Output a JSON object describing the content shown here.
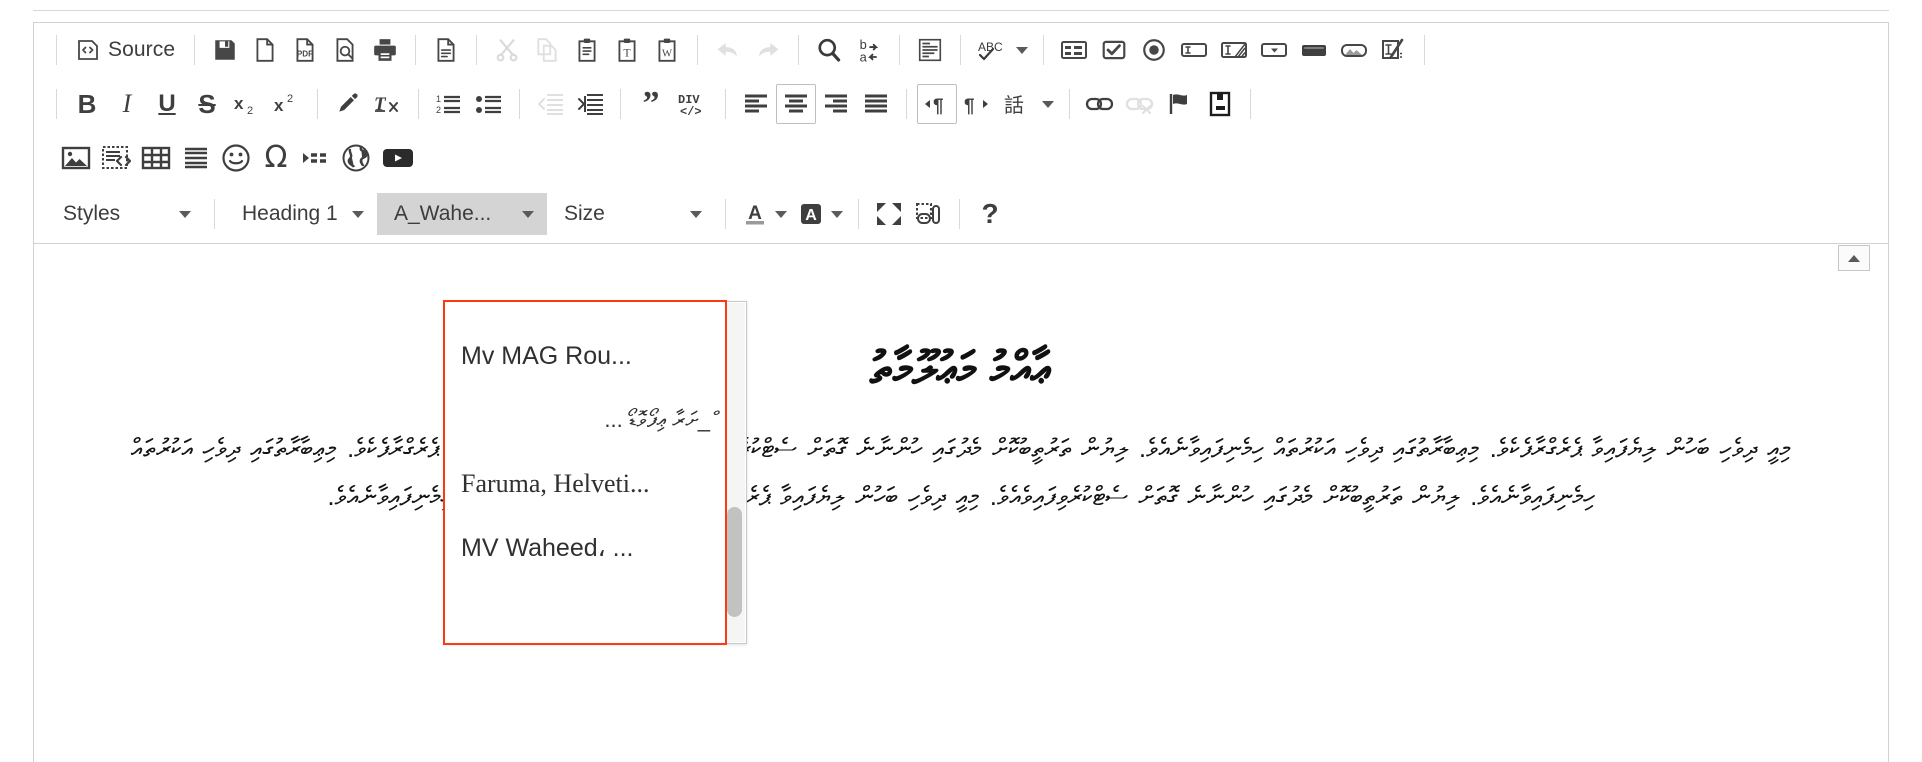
{
  "editor": {
    "name": "rich-text-editor"
  },
  "toolbar": {
    "row1": [
      {
        "name": "source-button",
        "label": "Source",
        "icon": "source-code-icon",
        "type": "text",
        "state": "normal"
      },
      {
        "type": "separator"
      },
      {
        "name": "save-button",
        "icon": "floppy-disk-icon",
        "state": "normal"
      },
      {
        "name": "new-page-button",
        "icon": "blank-page-icon",
        "state": "normal"
      },
      {
        "name": "export-pdf-button",
        "icon": "pdf-page-icon",
        "state": "normal"
      },
      {
        "name": "preview-button",
        "icon": "page-magnifier-icon",
        "state": "normal"
      },
      {
        "name": "print-button",
        "icon": "printer-icon",
        "state": "normal"
      },
      {
        "type": "separator"
      },
      {
        "name": "templates-button",
        "icon": "document-lines-icon",
        "state": "normal"
      },
      {
        "type": "separator"
      },
      {
        "name": "cut-button",
        "icon": "scissors-icon",
        "state": "disabled"
      },
      {
        "name": "copy-button",
        "icon": "copy-pages-icon",
        "state": "disabled"
      },
      {
        "name": "paste-button",
        "icon": "clipboard-icon",
        "state": "normal"
      },
      {
        "name": "paste-as-text-button",
        "icon": "clipboard-text-icon",
        "state": "normal"
      },
      {
        "name": "paste-from-word-button",
        "icon": "clipboard-word-icon",
        "state": "normal"
      },
      {
        "type": "separator"
      },
      {
        "name": "undo-button",
        "icon": "undo-arrow-icon",
        "state": "disabled"
      },
      {
        "name": "redo-button",
        "icon": "redo-arrow-icon",
        "state": "disabled"
      },
      {
        "type": "separator"
      },
      {
        "name": "find-button",
        "icon": "magnifier-icon",
        "state": "normal"
      },
      {
        "name": "replace-button",
        "icon": "find-replace-icon",
        "state": "normal"
      },
      {
        "type": "separator"
      },
      {
        "name": "select-all-button",
        "icon": "select-all-icon",
        "state": "normal"
      },
      {
        "type": "separator"
      },
      {
        "name": "spell-check-button",
        "icon": "abc-spellcheck-icon",
        "state": "normal",
        "hasCaret": true
      },
      {
        "type": "separator"
      },
      {
        "name": "form-button",
        "icon": "form-icon",
        "state": "normal"
      },
      {
        "name": "checkbox-button",
        "icon": "checkbox-icon",
        "state": "normal"
      },
      {
        "name": "radio-button",
        "icon": "radio-button-icon",
        "state": "normal"
      },
      {
        "name": "text-field-button",
        "icon": "text-field-icon",
        "state": "normal"
      },
      {
        "name": "textarea-button",
        "icon": "textarea-icon",
        "state": "normal"
      },
      {
        "name": "select-field-button",
        "icon": "select-field-icon",
        "state": "normal"
      },
      {
        "name": "button-field-button",
        "icon": "push-button-icon",
        "state": "normal"
      },
      {
        "name": "image-button-button",
        "icon": "image-button-icon",
        "state": "normal"
      },
      {
        "name": "hidden-field-button",
        "icon": "hidden-field-icon",
        "state": "normal"
      }
    ],
    "row2": [
      {
        "name": "bold-button",
        "icon": "bold-icon",
        "glyph": "B",
        "state": "normal"
      },
      {
        "name": "italic-button",
        "icon": "italic-icon",
        "glyph": "I",
        "state": "normal"
      },
      {
        "name": "underline-button",
        "icon": "underline-icon",
        "glyph": "U",
        "state": "normal"
      },
      {
        "name": "strikethrough-button",
        "icon": "strikethrough-icon",
        "glyph": "S",
        "state": "normal"
      },
      {
        "name": "subscript-button",
        "icon": "subscript-icon",
        "state": "normal"
      },
      {
        "name": "superscript-button",
        "icon": "superscript-icon",
        "state": "normal"
      },
      {
        "type": "separator"
      },
      {
        "name": "remove-format-button",
        "icon": "paintbrush-icon",
        "state": "normal"
      },
      {
        "name": "clear-text-format-button",
        "icon": "text-clear-icon",
        "state": "normal"
      },
      {
        "type": "separator"
      },
      {
        "name": "numbered-list-button",
        "icon": "numbered-list-icon",
        "state": "normal"
      },
      {
        "name": "bulleted-list-button",
        "icon": "bulleted-list-icon",
        "state": "normal"
      },
      {
        "type": "separator"
      },
      {
        "name": "decrease-indent-button",
        "icon": "outdent-icon",
        "state": "disabled"
      },
      {
        "name": "increase-indent-button",
        "icon": "indent-icon",
        "state": "normal"
      },
      {
        "type": "separator"
      },
      {
        "name": "blockquote-button",
        "icon": "quote-icon",
        "state": "normal"
      },
      {
        "name": "create-div-button",
        "icon": "div-container-icon",
        "state": "normal"
      },
      {
        "type": "separator"
      },
      {
        "name": "align-left-button",
        "icon": "align-left-icon",
        "state": "normal"
      },
      {
        "name": "align-center-button",
        "icon": "align-center-icon",
        "state": "active"
      },
      {
        "name": "align-right-button",
        "icon": "align-right-icon",
        "state": "normal"
      },
      {
        "name": "align-justify-button",
        "icon": "align-justify-icon",
        "state": "normal"
      },
      {
        "type": "separator"
      },
      {
        "name": "text-direction-rtl-button",
        "icon": "paragraph-rtl-icon",
        "state": "active"
      },
      {
        "name": "text-direction-ltr-button",
        "icon": "paragraph-ltr-icon",
        "state": "normal"
      },
      {
        "name": "language-button",
        "icon": "language-cjk-icon",
        "state": "normal",
        "hasCaret": true
      },
      {
        "type": "separator"
      },
      {
        "name": "link-button",
        "icon": "link-icon",
        "state": "normal"
      },
      {
        "name": "unlink-button",
        "icon": "unlink-icon",
        "state": "disabled"
      },
      {
        "name": "anchor-button",
        "icon": "flag-anchor-icon",
        "state": "normal"
      },
      {
        "name": "save-doc-button",
        "icon": "save-doc-icon",
        "state": "normal"
      },
      {
        "type": "separator"
      }
    ],
    "row3": [
      {
        "name": "insert-image-button",
        "icon": "picture-icon",
        "state": "normal"
      },
      {
        "name": "code-snippet-button",
        "icon": "code-snippet-icon",
        "state": "normal"
      },
      {
        "name": "insert-table-button",
        "icon": "table-icon",
        "state": "normal"
      },
      {
        "name": "horizontal-rule-button",
        "icon": "horizontal-rule-icon",
        "state": "normal"
      },
      {
        "name": "smiley-button",
        "icon": "smiley-icon",
        "state": "normal"
      },
      {
        "name": "special-character-button",
        "icon": "omega-icon",
        "state": "normal"
      },
      {
        "name": "page-break-button",
        "icon": "page-break-icon",
        "state": "normal"
      },
      {
        "name": "iframe-button",
        "icon": "globe-icon",
        "state": "normal"
      },
      {
        "name": "youtube-button",
        "icon": "youtube-icon",
        "state": "normal"
      }
    ],
    "row4": {
      "styles": {
        "name": "styles-combo",
        "value": "Styles"
      },
      "format": {
        "name": "paragraph-format-combo",
        "value": "Heading 1"
      },
      "font": {
        "name": "font-family-combo",
        "value": "A_Wahe..."
      },
      "size": {
        "name": "font-size-combo",
        "value": "Size"
      },
      "text_color": {
        "name": "text-color-button",
        "icon": "text-color-icon"
      },
      "bg_color": {
        "name": "background-color-button",
        "icon": "background-color-icon"
      },
      "maximize": {
        "name": "maximize-button",
        "icon": "maximize-arrows-icon"
      },
      "show_blocks": {
        "name": "show-blocks-button",
        "icon": "show-blocks-icon"
      },
      "about": {
        "name": "about-button",
        "label": "?"
      }
    },
    "collapse": {
      "name": "collapse-toolbar-button",
      "icon": "chevron-up-icon"
    }
  },
  "font_dropdown": {
    "name": "font-family-dropdown",
    "items": [
      {
        "label": "Mv MAG Rou...",
        "style": "sans"
      },
      {
        "label": "ް_ށަރާ ޢިފޯވޮޑޯ ...",
        "style": "thaana"
      },
      {
        "label": "Faruma,  Helveti...",
        "style": "serif"
      },
      {
        "label": "MV  Waheed،  ...",
        "style": "sans"
      }
    ],
    "highlight_color": "#f93a12"
  },
  "document": {
    "name": "document-body",
    "heading": "ޢާއްމު މަޢުލޫމާތު",
    "paragraph": "މިއީ ދިވެހި ބަހުން ލިޔެފައިވާ ޕެރެގްރާފެކެވެ. މިޢިބާރާތުގައި ދިވެހި އަކުރުތައް ހިމެނިފައިވާނެއެވެ. ލިޔުން ތަރުތީބުކޮށް މެދުގައި ހުންނާނެ ގޮތަށް ސެޓްކުރެވިފައިވެއެވެ. މިއީ ދިވެހި ބަހުން ލިޔެފައިވާ ޕެރެގްރާފެކެވެ. މިޢިބާރާތުގައި ދިވެހި އަކުރުތައް ހިމެނިފައިވާނެއެވެ. ލިޔުން ތަރުތީބުކޮށް މެދުގައި ހުންނާނެ ގޮތަށް ސެޓްކުރެވިފައިވެއެވެ. މިއީ ދިވެހި ބަހުން ލިޔެފައިވާ ޕެރެގްރާފެކެވެ. މިޢިބާރާތުގައި ދިވެހި އަކުރުތައް ހިމެނިފައިވާނެއެވެ."
  }
}
